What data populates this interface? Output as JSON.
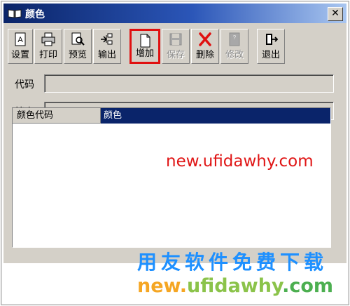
{
  "window": {
    "title": "颜色",
    "close_label": "✕"
  },
  "toolbar": {
    "buttons": [
      {
        "label": "设置",
        "icon": "settings-icon",
        "enabled": true
      },
      {
        "label": "打印",
        "icon": "printer-icon",
        "enabled": true
      },
      {
        "label": "预览",
        "icon": "preview-icon",
        "enabled": true
      },
      {
        "label": "输出",
        "icon": "export-icon",
        "enabled": true
      },
      {
        "label": "增加",
        "icon": "new-document-icon",
        "enabled": true,
        "highlighted": true
      },
      {
        "label": "保存",
        "icon": "save-icon",
        "enabled": false
      },
      {
        "label": "删除",
        "icon": "delete-icon",
        "enabled": true
      },
      {
        "label": "修改",
        "icon": "edit-icon",
        "enabled": false
      },
      {
        "label": "退出",
        "icon": "exit-icon",
        "enabled": true
      }
    ]
  },
  "form": {
    "code_label": "代码",
    "code_value": "",
    "archive_label": "档案",
    "archive_value": ""
  },
  "grid": {
    "columns": [
      "颜色代码",
      "颜色"
    ],
    "rows": []
  },
  "watermarks": {
    "url_red": "new.ufidawhy.com",
    "slogan": "用友软件免费下载",
    "url_color": "new.ufidawhy.com"
  },
  "colors": {
    "title_gradient_start": "#0a2468",
    "header_selected": "#0a246a",
    "highlight_border": "#e01010",
    "slogan": "#1e90ff"
  }
}
